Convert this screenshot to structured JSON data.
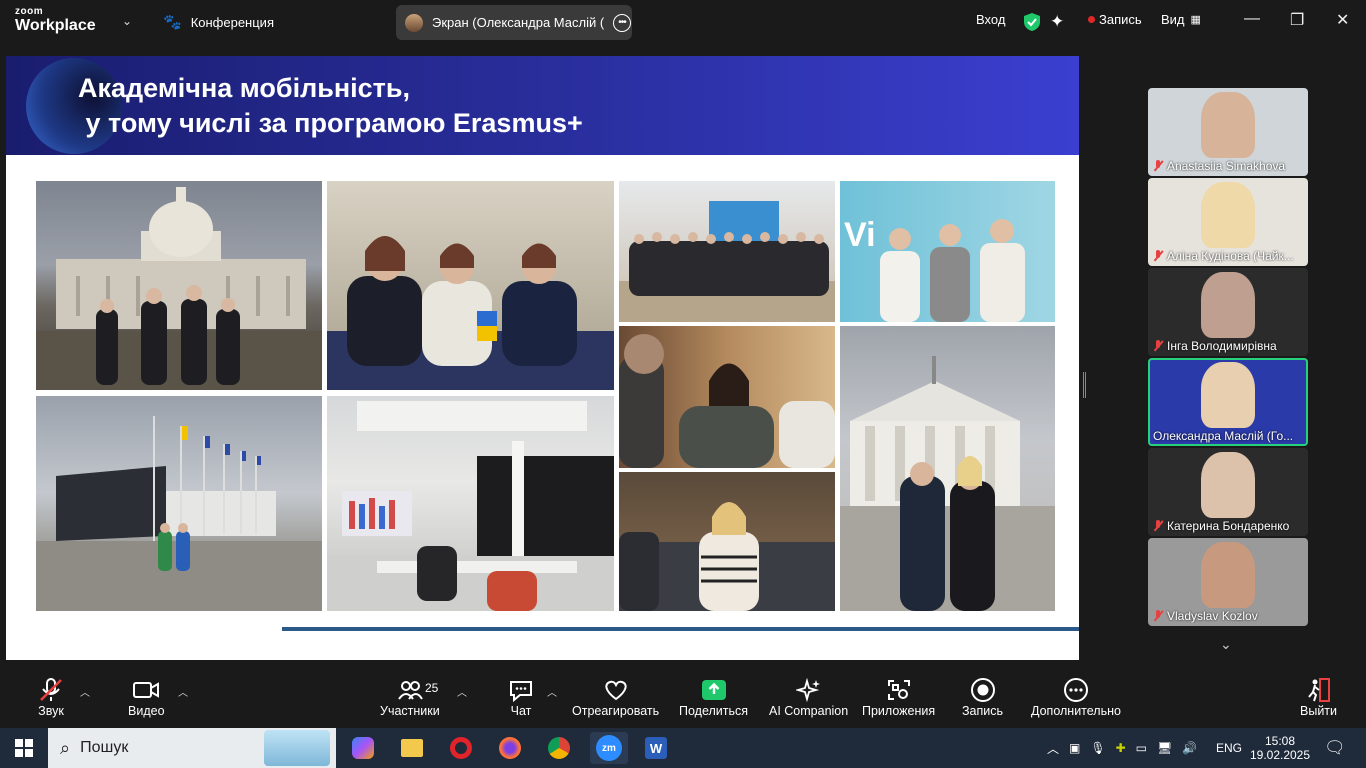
{
  "app": {
    "logo_line1": "zoom",
    "logo_line2": "Workplace",
    "meeting_label": "Конференция",
    "screen_share_label": "Экран (Олександра Маслій (Гол",
    "login": "Вход",
    "record_status": "Запись",
    "view": "Вид",
    "accent_color": "#2d8cff",
    "record_color": "#e02828"
  },
  "slide": {
    "title": "Академічна мобільність,\n у тому числі за програмою Erasmus+",
    "photos": [
      {
        "name": "photo-capitol",
        "desc": "Capitol"
      },
      {
        "name": "photo-meeting-table",
        "desc": "meeting"
      },
      {
        "name": "photo-group",
        "desc": "group"
      },
      {
        "name": "photo-vikio",
        "desc": "VikO"
      },
      {
        "name": "photo-building-flags",
        "desc": "flags"
      },
      {
        "name": "photo-classroom",
        "desc": "classroom"
      },
      {
        "name": "photo-audience",
        "desc": "audience"
      },
      {
        "name": "photo-cathedral",
        "desc": "cathedral"
      },
      {
        "name": "photo-seated-woman",
        "desc": "seated"
      }
    ]
  },
  "gallery": {
    "tiles": [
      {
        "name": "Anastasiia Simakhova",
        "muted": true,
        "active": false,
        "bg": "#cfd5d8",
        "face": "#d7b39a"
      },
      {
        "name": "Аліна Кудінова (Чайк...",
        "muted": true,
        "active": false,
        "bg": "#e6e2dc",
        "face": "#f0d9a8"
      },
      {
        "name": "Інга Володимирівна",
        "muted": true,
        "active": false,
        "bg": "#2b2b2b",
        "face": "#bfa090"
      },
      {
        "name": "Олександра Маслій (Го...",
        "muted": false,
        "active": true,
        "bg": "#2a3aa8",
        "face": "#e8cfb0"
      },
      {
        "name": "Катерина Бондаренко",
        "muted": true,
        "active": false,
        "bg": "#2b2b2b",
        "face": "#dcc2aa"
      },
      {
        "name": "Vladyslav Kozlov",
        "muted": true,
        "active": false,
        "bg": "#9a9a9a",
        "face": "#c79a80"
      }
    ]
  },
  "toolbar": {
    "audio": "Звук",
    "video": "Видео",
    "participants": "Участники",
    "participants_count": "25",
    "chat": "Чат",
    "react": "Отреагировать",
    "share": "Поделиться",
    "ai": "AI Companion",
    "apps": "Приложения",
    "record": "Запись",
    "more": "Дополнительно",
    "leave": "Выйти"
  },
  "taskbar": {
    "search_placeholder": "Пошук",
    "lang": "ENG",
    "time": "15:08",
    "date": "19.02.2025"
  }
}
